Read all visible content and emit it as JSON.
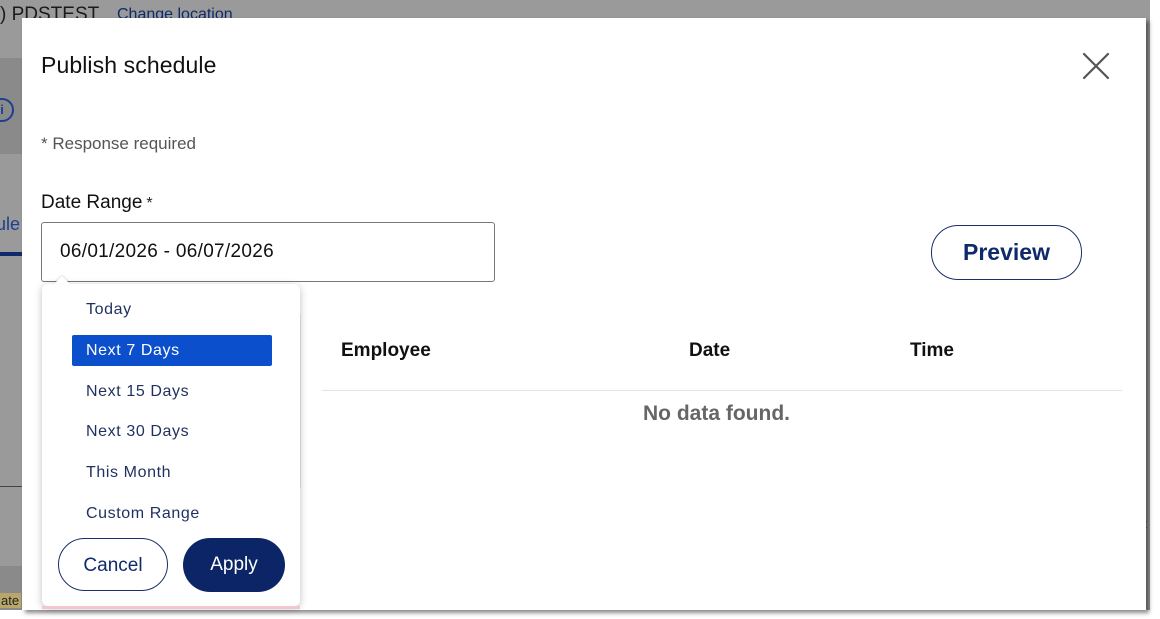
{
  "background": {
    "header_text": ") PDSTEST",
    "header_link": "Change location",
    "tab_text": "ule",
    "bottom_text": "ate"
  },
  "modal": {
    "title": "Publish schedule",
    "required_note": "* Response required",
    "date_range": {
      "label": "Date Range",
      "required_marker": "*",
      "value": "06/01/2026 - 06/07/2026"
    },
    "preview_label": "Preview",
    "table": {
      "columns": [
        "Employee",
        "Date",
        "Time"
      ],
      "empty_message": "No data found."
    }
  },
  "dropdown": {
    "options": [
      "Today",
      "Next 7 Days",
      "Next 15 Days",
      "Next 30 Days",
      "This Month",
      "Custom Range"
    ],
    "selected": "Next 7 Days",
    "cancel_label": "Cancel",
    "apply_label": "Apply"
  },
  "colors": {
    "primary_navy": "#0c2566",
    "selected_blue": "#0b4fcc",
    "link_blue": "#0e2a6b"
  }
}
